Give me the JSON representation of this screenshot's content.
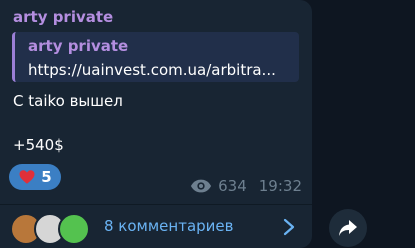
{
  "message": {
    "sender": "arty private",
    "reply": {
      "title": "arty private",
      "text": "https://uainvest.com.ua/arbitra..."
    },
    "lines": [
      "С taiko вышел",
      "+540$"
    ],
    "reaction": {
      "icon": "red-heart-icon",
      "count": "5"
    },
    "views": "634",
    "time": "19:32"
  },
  "comments": {
    "label": "8 комментариев",
    "avatars": [
      "avatar-1",
      "avatar-2",
      "avatar-3"
    ]
  },
  "colors": {
    "background": "#0e1621",
    "bubble": "#182533",
    "sender": "#b48ee0",
    "link": "#6ab3f3",
    "reaction": "#3b7fc4",
    "meta": "#6d7f8f"
  },
  "icons": {
    "views": "eye-icon",
    "chevron": "chevron-right-icon",
    "share": "share-icon"
  }
}
